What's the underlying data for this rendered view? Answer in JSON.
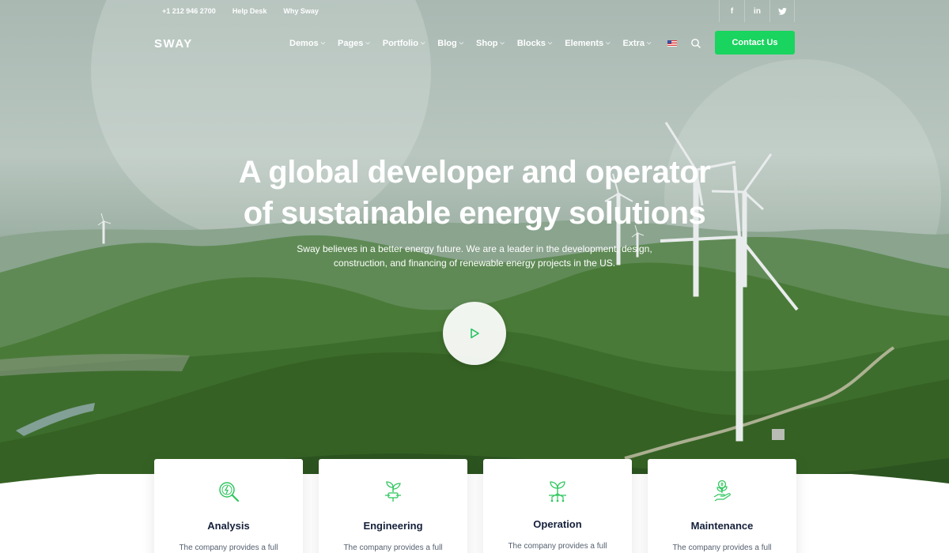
{
  "topbar": {
    "phone": "+1 212 946 2700",
    "help": "Help Desk",
    "why": "Why Sway",
    "social": [
      {
        "icon": "facebook-icon",
        "glyph": "f"
      },
      {
        "icon": "linkedin-icon",
        "glyph": "in"
      },
      {
        "icon": "twitter-icon",
        "glyph": "❧"
      }
    ]
  },
  "nav": {
    "logo": "SWAY",
    "items": [
      "Demos",
      "Pages",
      "Portfolio",
      "Blog",
      "Shop",
      "Blocks",
      "Elements",
      "Extra"
    ],
    "contact_label": "Contact Us"
  },
  "hero": {
    "headline_line1": "A global developer and operator",
    "headline_line2": "of sustainable energy solutions",
    "subtext_line1": "Sway believes in a better energy future. We are a leader in the development, design,",
    "subtext_line2": "construction, and financing of renewable energy projects in the US."
  },
  "cards": [
    {
      "title": "Analysis",
      "desc": "The company provides a full",
      "icon": "magnifier-energy-icon"
    },
    {
      "title": "Engineering",
      "desc": "The company provides a full",
      "icon": "plant-plug-icon"
    },
    {
      "title": "Operation",
      "desc": "The company provides a full",
      "icon": "plant-circuit-icon"
    },
    {
      "title": "Maintenance",
      "desc": "The company provides a full",
      "icon": "hand-coin-plant-icon"
    }
  ],
  "colors": {
    "accent": "#19d45f",
    "card_title": "#15203a",
    "icon": "#2fc65e"
  }
}
